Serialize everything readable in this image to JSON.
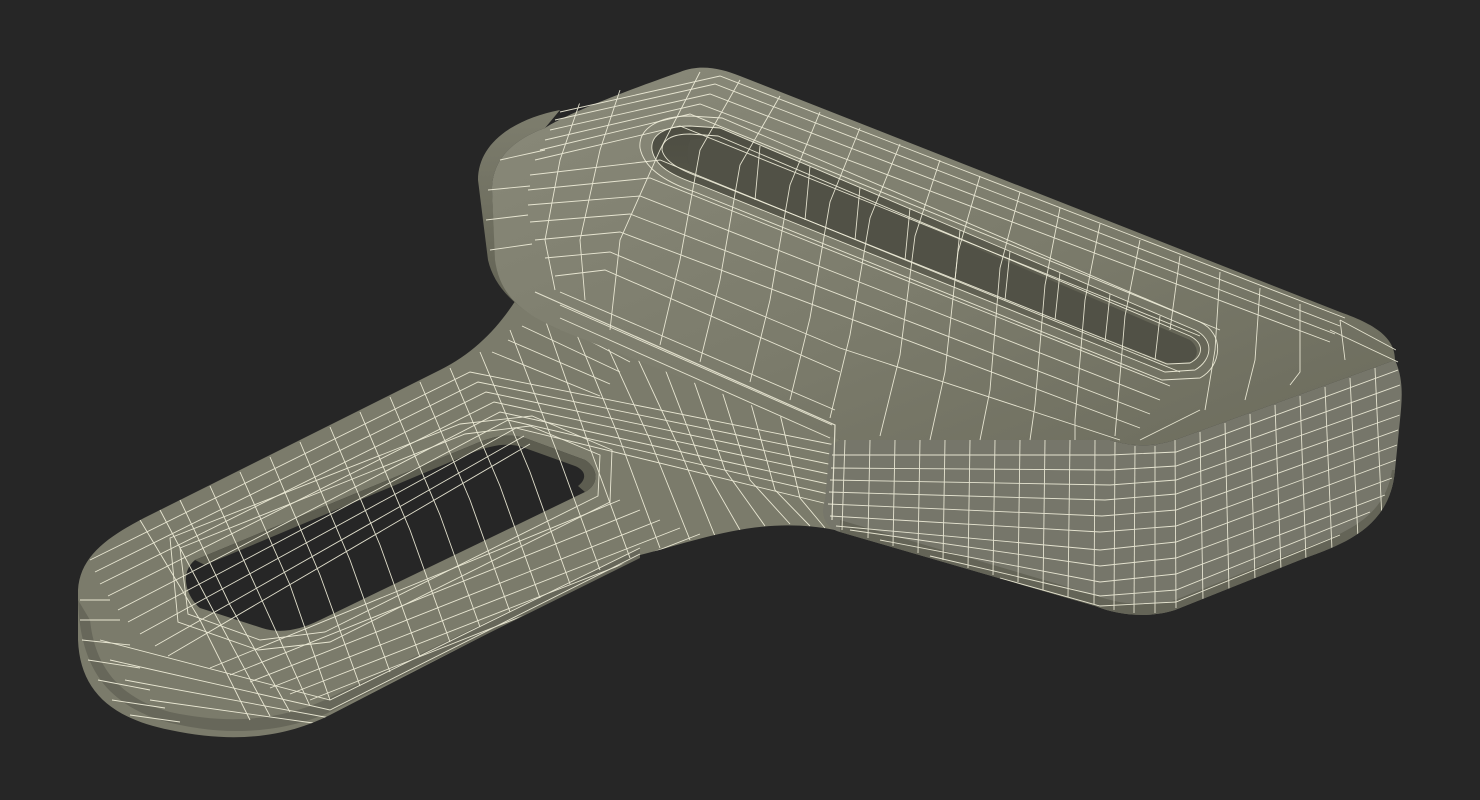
{
  "viewport": {
    "background_color": "#262626",
    "model": {
      "subject": "seat-belt-buckle-tongue",
      "render_mode": "wireframe-over-shaded",
      "surface_color": "#7b7b6b",
      "surface_dark_color": "#575648",
      "wire_color": "#f2f0dc",
      "hole_color": "#262626"
    }
  }
}
